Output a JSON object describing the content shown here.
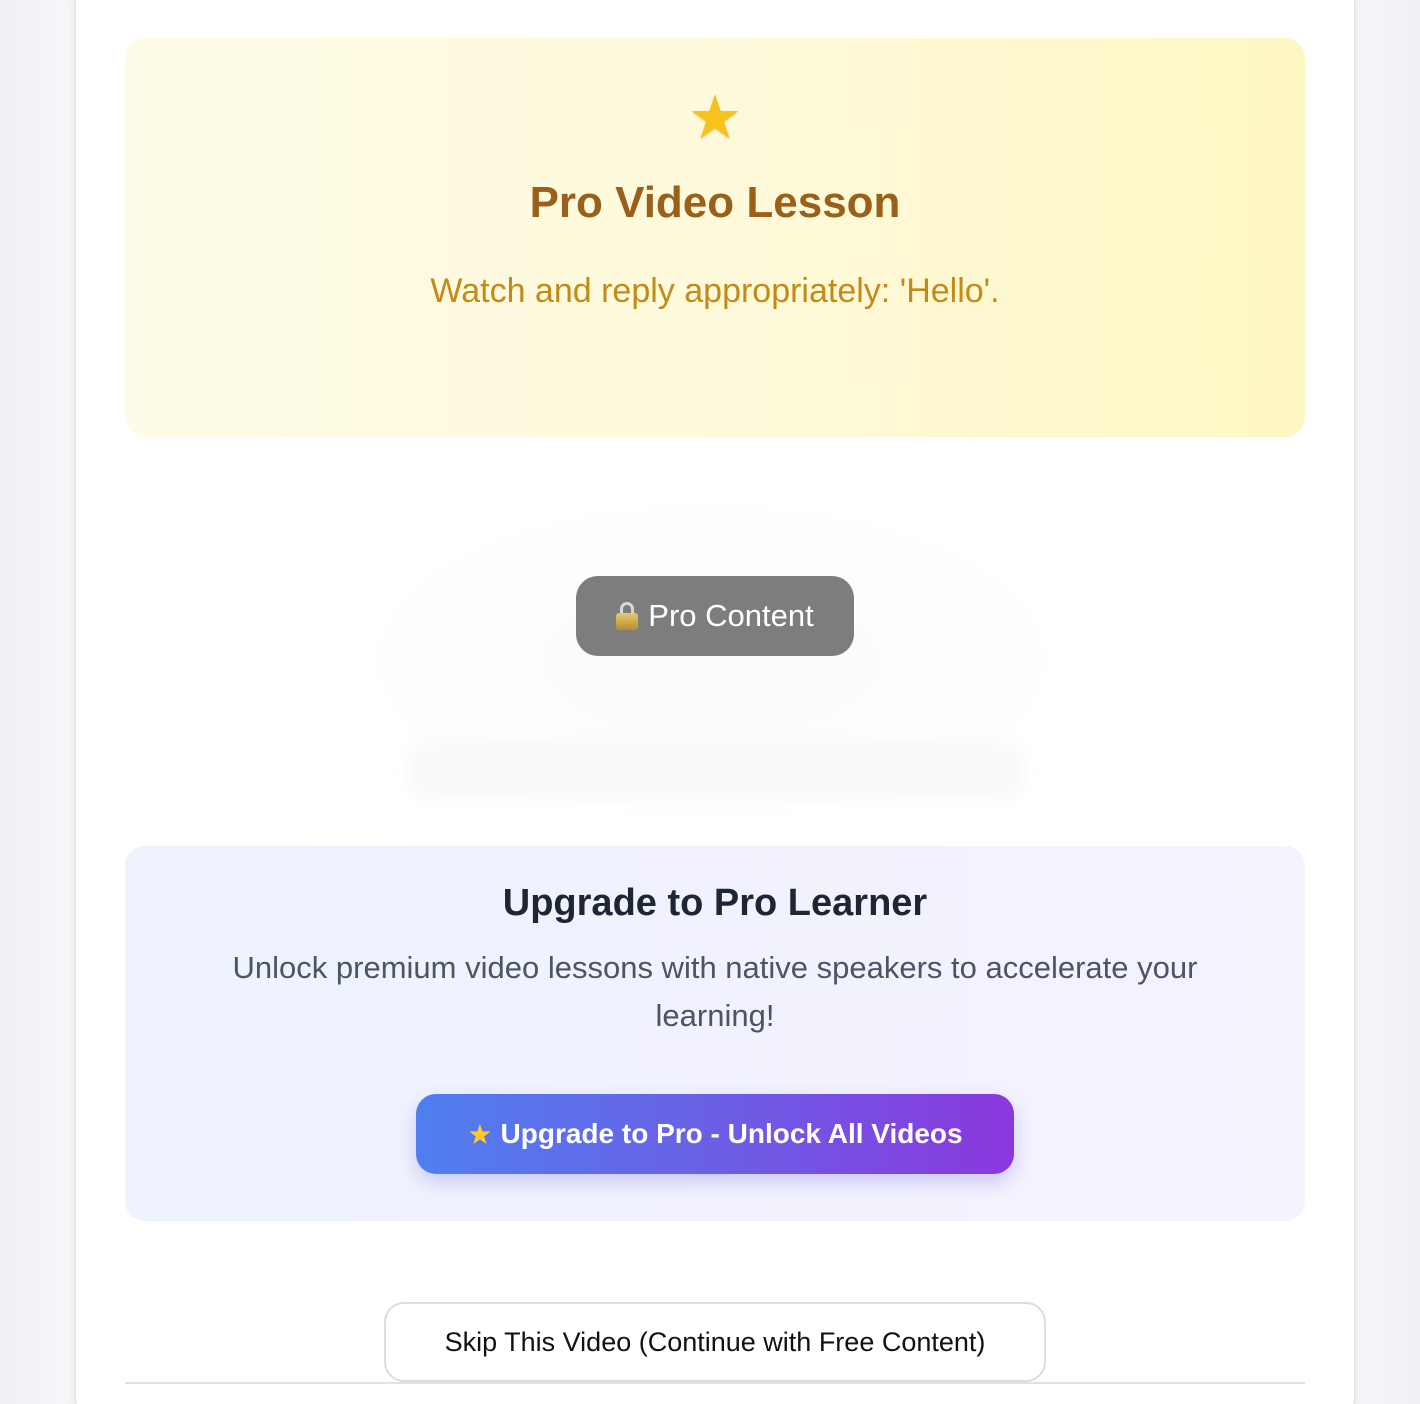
{
  "hero": {
    "icon": "star-icon",
    "star_glyph": "★",
    "title": "Pro Video Lesson",
    "subtitle": "Watch and reply appropriately: 'Hello'."
  },
  "video": {
    "lock_label": "Pro Content"
  },
  "upgrade": {
    "title": "Upgrade to Pro Learner",
    "description": "Unlock premium video lessons with native speakers to accelerate your learning!",
    "button_star": "★",
    "button_label": "Upgrade to Pro - Unlock All Videos"
  },
  "skip": {
    "button_label": "Skip This Video (Continue with Free Content)"
  },
  "colors": {
    "hero_title": "#9a5f18",
    "hero_subtitle": "#c48a18",
    "accent_start": "#4f7ff0",
    "accent_end": "#8a38dd",
    "pill": "#7d7d7d"
  }
}
